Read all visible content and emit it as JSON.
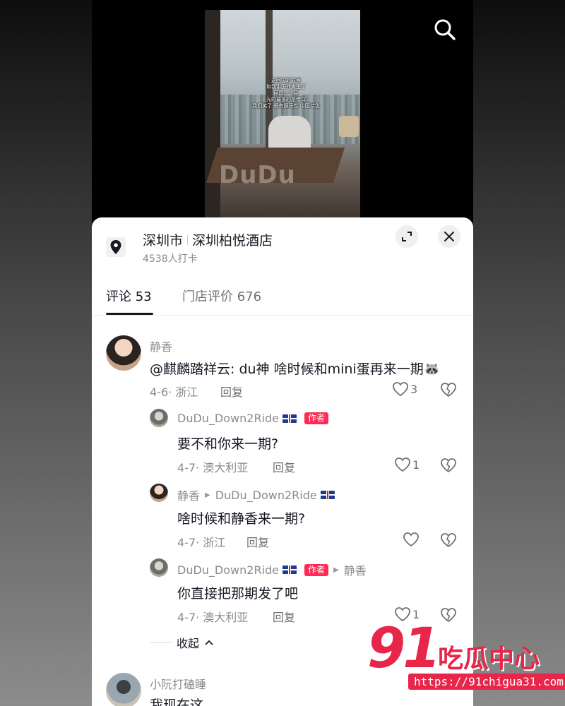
{
  "video": {
    "caption_lines": [
      "这回国的时候",
      "和我讲国外爽歪了",
      "回国一个月",
      "光的最多的是借口",
      "我们笑了 很有娱乐性 中国持色"
    ],
    "watermark": "DuDu"
  },
  "location": {
    "city": "深圳市",
    "place": "深圳柏悦酒店",
    "checkins": "4538人打卡"
  },
  "tabs": [
    {
      "label": "评论 53",
      "active": true
    },
    {
      "label": "门店评价 676",
      "active": false
    }
  ],
  "comments": [
    {
      "user": "静香",
      "text": "@麒麟踏祥云: du神  啥时候和mini蛋再来一期🦝",
      "meta": "4-6· 浙江",
      "reply": "回复",
      "likes": "3"
    },
    {
      "user": "DuDu_Down2Ride",
      "badge": "作者",
      "text": "要不和你来一期?",
      "meta": "4-7· 澳大利亚",
      "reply": "回复",
      "likes": "1"
    },
    {
      "user": "静香",
      "reply_to": "DuDu_Down2Ride",
      "text": "啥时候和静香来一期?",
      "meta": "4-7· 浙江",
      "reply": "回复",
      "likes": ""
    },
    {
      "user": "DuDu_Down2Ride",
      "badge": "作者",
      "reply_to": "静香",
      "text": "你直接把那期发了吧",
      "meta": "4-7· 澳大利亚",
      "reply": "回复",
      "likes": "1"
    }
  ],
  "collapse_label": "收起",
  "next_comment": {
    "user": "小阮打磕睡",
    "text": "我现在这"
  },
  "site": {
    "number": "91",
    "name": "吃瓜中心",
    "url": "https://91chigua31.com"
  }
}
